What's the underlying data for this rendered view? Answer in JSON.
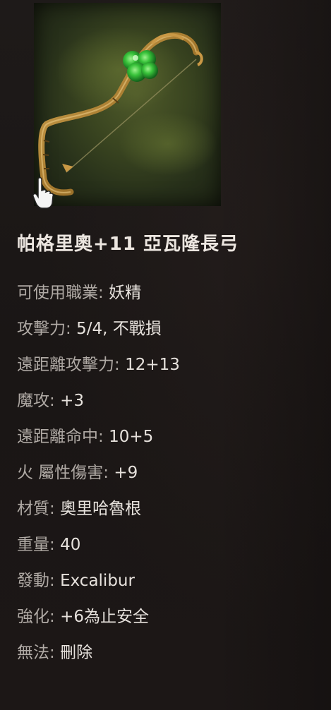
{
  "item": {
    "name": "帕格里奧+11 亞瓦隆長弓",
    "image_icon": "longbow-with-green-gem-icon",
    "stats": [
      {
        "label": "可使用職業: ",
        "value": "妖精"
      },
      {
        "label": "攻擊力: ",
        "value": "5/4, 不戰損"
      },
      {
        "label": "遠距離攻擊力: ",
        "value": "12+13"
      },
      {
        "label": "魔攻: ",
        "value": "+3"
      },
      {
        "label": "遠距離命中: ",
        "value": "10+5"
      },
      {
        "label": "火 屬性傷害: ",
        "value": "+9"
      },
      {
        "label": "材質: ",
        "value": "奧里哈魯根"
      },
      {
        "label": "重量: ",
        "value": "40"
      },
      {
        "label": "發動: ",
        "value": "Excalibur"
      },
      {
        "label": "強化: ",
        "value": "+6為止安全"
      },
      {
        "label": "無法: ",
        "value": "刪除"
      }
    ]
  },
  "colors": {
    "background": "#1b1716",
    "name_text": "#ece6e0",
    "label_text": "#b0aaa5",
    "value_text": "#e6e1dc",
    "gem": "#3fbf3a",
    "bow": "#b88a3a"
  },
  "cursor_icon": "hand-pointer-icon"
}
